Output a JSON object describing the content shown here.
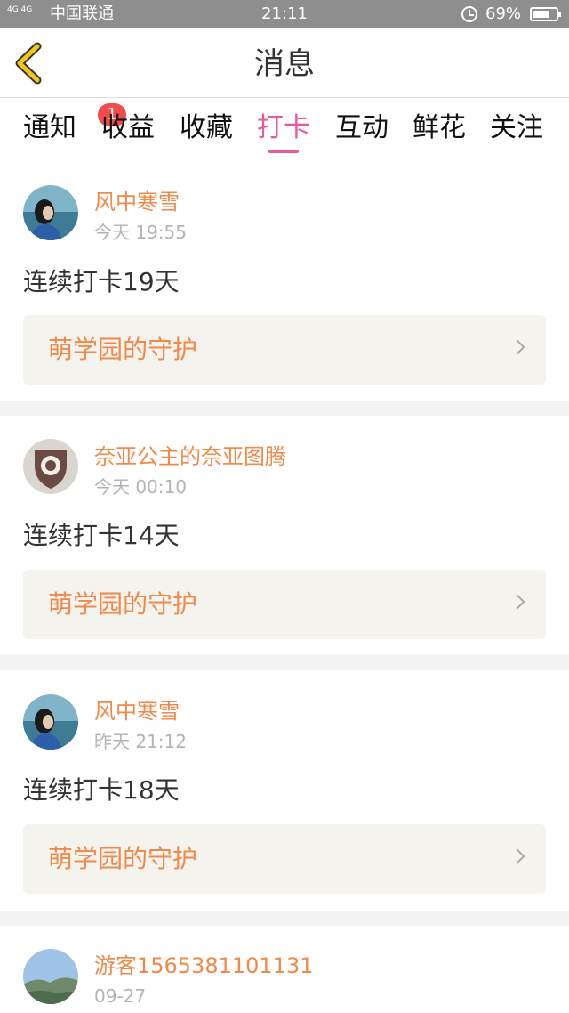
{
  "status_bar": {
    "network": "4G 4G",
    "carrier": "中国联通",
    "time": "21:11",
    "alarm_icon": "alarm-clock-icon",
    "battery_percent": "69%",
    "battery_level": 0.69
  },
  "nav": {
    "back_icon": "back-chevron-icon",
    "title": "消息",
    "accent_color": "#f5c518"
  },
  "tabs": [
    {
      "label": "通知",
      "badge": "1"
    },
    {
      "label": "收益"
    },
    {
      "label": "收藏"
    },
    {
      "label": "打卡",
      "active": true
    },
    {
      "label": "互动"
    },
    {
      "label": "鲜花"
    },
    {
      "label": "关注"
    }
  ],
  "colors": {
    "active_tab": "#ea5a9a",
    "username": "#f08a4b",
    "badge": "#f24b4b"
  },
  "posts": [
    {
      "avatar": "girl-seaside-avatar",
      "user": "风中寒雪",
      "time": "今天 19:55",
      "text": "连续打卡19天",
      "link": "萌学园的守护"
    },
    {
      "avatar": "totem-shield-avatar",
      "user": "奈亚公主的奈亚图腾",
      "time": "今天 00:10",
      "text": "连续打卡14天",
      "link": "萌学园的守护"
    },
    {
      "avatar": "girl-seaside-avatar",
      "user": "风中寒雪",
      "time": "昨天 21:12",
      "text": "连续打卡18天",
      "link": "萌学园的守护"
    },
    {
      "avatar": "landscape-avatar",
      "user": "游客1565381101131",
      "time": "09-27"
    }
  ]
}
